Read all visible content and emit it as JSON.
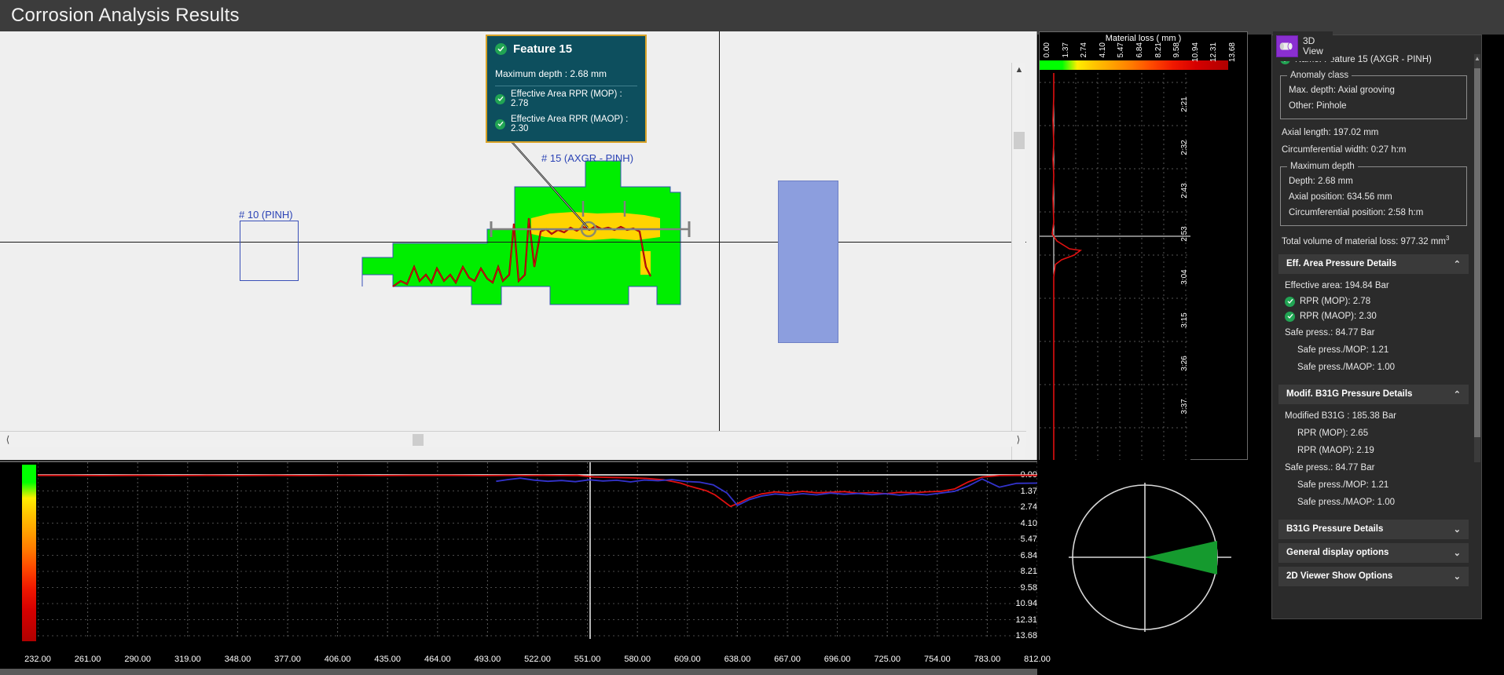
{
  "window": {
    "title": "Corrosion Analysis Results"
  },
  "view_button": {
    "icon": "pipe-3d-icon",
    "label_line1": "3D",
    "label_line2": "View"
  },
  "viewer2d": {
    "features": [
      {
        "label": "# 10 (PINH)"
      },
      {
        "label": "# 15 (AXGR - PINH)"
      }
    ]
  },
  "tooltip": {
    "title": "Feature 15",
    "max_depth": "Maximum depth : 2.68 mm",
    "rows": [
      {
        "label": "Effective Area RPR (MOP) : 2.78",
        "status": "ok"
      },
      {
        "label": "Effective Area RPR (MAOP) : 2.30",
        "status": "ok"
      }
    ],
    "border_color": "#d8a227",
    "background_color": "#0d4f5e"
  },
  "material_loss_scale": {
    "title": "Material loss ( mm )",
    "ticks": [
      "0.00",
      "1.37",
      "2.74",
      "4.10",
      "5.47",
      "6.84",
      "8.21",
      "9.58",
      "10.94",
      "12.31",
      "13.68"
    ]
  },
  "mid_panel": {
    "clock_ticks": [
      "2:21",
      "2:32",
      "2:43",
      "2:53",
      "3:04",
      "3:15",
      "3:26",
      "3:37"
    ]
  },
  "details": {
    "name": "Name: Feature 15 (AXGR - PINH)",
    "anomaly_class": {
      "legend": "Anomaly class",
      "max_depth": "Max. depth: Axial grooving",
      "other": "Other: Pinhole"
    },
    "axial_length": "Axial length: 197.02 mm",
    "circumferential_width": "Circumferential width: 0:27 h:m",
    "maximum_depth": {
      "legend": "Maximum depth",
      "depth": "Depth: 2.68 mm",
      "axial_position": "Axial position: 634.56 mm",
      "circumferential_position": "Circumferential position: 2:58 h:m"
    },
    "total_volume_label": "Total volume of material loss: 977.32 mm",
    "total_volume_sup": "3"
  },
  "sections": [
    {
      "title": "Eff. Area Pressure Details",
      "expanded": true,
      "chevron": "collapse-chevron",
      "rows": [
        {
          "text": "Effective area: 194.84 Bar",
          "type": "plain"
        },
        {
          "text": "RPR (MOP): 2.78",
          "type": "check"
        },
        {
          "text": "RPR (MAOP): 2.30",
          "type": "check"
        },
        {
          "text": "Safe press.: 84.77 Bar",
          "type": "plain"
        },
        {
          "text": "Safe press./MOP: 1.21",
          "type": "indent"
        },
        {
          "text": "Safe press./MAOP: 1.00",
          "type": "indent"
        }
      ]
    },
    {
      "title": "Modif. B31G Pressure Details",
      "expanded": true,
      "chevron": "collapse-chevron",
      "rows": [
        {
          "text": "Modified B31G : 185.38 Bar",
          "type": "plain"
        },
        {
          "text": "RPR (MOP): 2.65",
          "type": "indent"
        },
        {
          "text": "RPR (MAOP): 2.19",
          "type": "indent"
        },
        {
          "text": "Safe press.: 84.77 Bar",
          "type": "plain"
        },
        {
          "text": "Safe press./MOP: 1.21",
          "type": "indent"
        },
        {
          "text": "Safe press./MAOP: 1.00",
          "type": "indent"
        }
      ]
    },
    {
      "title": "B31G Pressure Details",
      "expanded": false,
      "chevron": "expand-chevron",
      "rows": []
    },
    {
      "title": "General display options",
      "expanded": false,
      "chevron": "expand-chevron",
      "rows": []
    },
    {
      "title": "2D Viewer Show Options",
      "expanded": false,
      "chevron": "expand-chevron",
      "rows": []
    }
  ],
  "chart_data": {
    "type": "line",
    "title": "",
    "xlabel": "",
    "ylabel": "Material loss ( mm )",
    "xticks": [
      "232.00",
      "261.00",
      "290.00",
      "319.00",
      "348.00",
      "377.00",
      "406.00",
      "435.00",
      "464.00",
      "493.00",
      "522.00",
      "551.00",
      "580.00",
      "609.00",
      "638.00",
      "667.00",
      "696.00",
      "725.00",
      "754.00",
      "783.00",
      "812.00"
    ],
    "yticks": [
      "0.00",
      "1.37",
      "2.74",
      "4.10",
      "5.47",
      "6.84",
      "8.21",
      "9.58",
      "10.94",
      "12.31",
      "13.68"
    ],
    "ylim": [
      0,
      13.68
    ],
    "xlim": [
      232,
      812
    ],
    "grid": true,
    "legend": "none",
    "series": [
      {
        "name": "red-trace",
        "color": "#e01010",
        "x": [
          232,
          250,
          270,
          290,
          310,
          330,
          350,
          370,
          390,
          410,
          430,
          450,
          470,
          490,
          505,
          515,
          525,
          535,
          545,
          555,
          565,
          575,
          585,
          595,
          600,
          605,
          610,
          615,
          620,
          625,
          630,
          634,
          638,
          645,
          652,
          660,
          668,
          676,
          684,
          692,
          700,
          708,
          716,
          724,
          732,
          740,
          748,
          756,
          764,
          772,
          780,
          790,
          800,
          812
        ],
        "y": [
          0.05,
          0.05,
          0.06,
          0.05,
          0.06,
          0.05,
          0.06,
          0.05,
          0.06,
          0.05,
          0.06,
          0.05,
          0.05,
          0.06,
          0.05,
          0.06,
          0.05,
          0.06,
          0.05,
          0.18,
          0.22,
          0.25,
          0.3,
          0.42,
          0.55,
          0.7,
          0.95,
          1.15,
          1.35,
          1.7,
          2.25,
          2.68,
          2.45,
          1.95,
          1.62,
          1.45,
          1.55,
          1.4,
          1.52,
          1.48,
          1.42,
          1.56,
          1.5,
          1.6,
          1.48,
          1.52,
          1.44,
          1.4,
          1.2,
          0.6,
          0.18,
          0.06,
          0.05,
          0.05
        ]
      },
      {
        "name": "blue-trace",
        "color": "#3333cc",
        "x": [
          498,
          505,
          512,
          520,
          528,
          536,
          544,
          552,
          560,
          568,
          576,
          584,
          592,
          600,
          608,
          616,
          624,
          632,
          638,
          645,
          652,
          660,
          668,
          676,
          684,
          692,
          700,
          708,
          716,
          724,
          732,
          740,
          748,
          756,
          764,
          772,
          780,
          790,
          800,
          812
        ],
        "y": [
          0.55,
          0.4,
          0.28,
          0.45,
          0.55,
          0.48,
          0.58,
          0.42,
          0.52,
          0.46,
          0.6,
          0.44,
          0.5,
          0.4,
          0.56,
          0.62,
          0.85,
          1.55,
          2.6,
          2.1,
          1.8,
          1.62,
          1.72,
          1.6,
          1.7,
          1.55,
          1.65,
          1.58,
          1.68,
          1.6,
          1.72,
          1.62,
          1.7,
          1.55,
          1.4,
          0.95,
          0.35,
          1.05,
          0.72,
          0.7
        ]
      }
    ]
  }
}
